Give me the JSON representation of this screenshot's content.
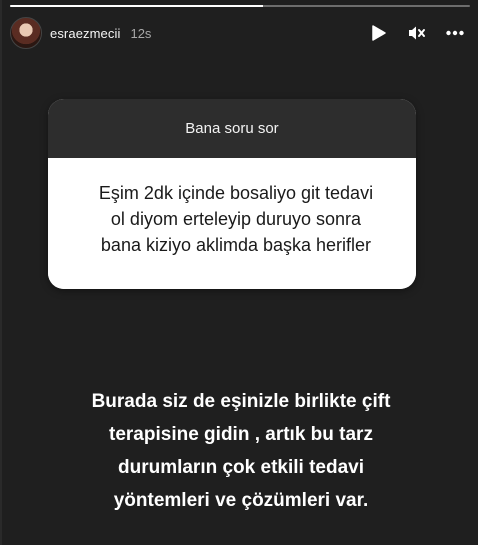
{
  "story": {
    "progress": 0.55,
    "username": "esraezmecii",
    "timestamp": "12s"
  },
  "controls": {
    "play_icon": "play-icon",
    "mute_icon": "speaker-muted-icon",
    "more_icon": "more-horizontal-icon"
  },
  "question_box": {
    "title": "Bana soru sor",
    "lines": [
      "Eşim 2dk içinde bosaliyo git tedavi",
      "ol diyom erteleyip duruyo sonra",
      "bana  kiziyo aklimda başka herifler"
    ]
  },
  "answer": {
    "lines": [
      "Burada siz de eşinizle birlikte çift",
      "terapisine gidin , artık bu tarz",
      "durumların çok etkili tedavi",
      "yöntemleri ve çözümleri var."
    ]
  },
  "colors": {
    "background": "#1f1f1f",
    "question_header": "#2d2d2d",
    "question_body": "#ffffff"
  }
}
